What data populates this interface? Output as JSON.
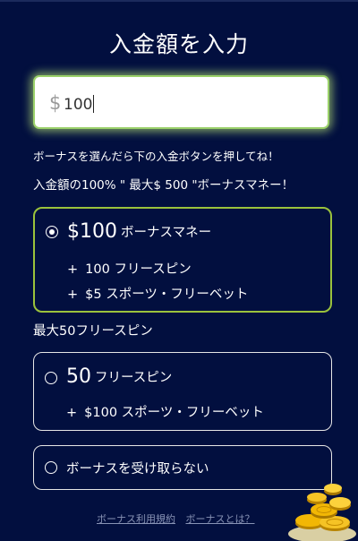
{
  "page": {
    "title": "入金額を入力"
  },
  "amount": {
    "currency": "$",
    "value": "100"
  },
  "hint": "ボーナスを選んだら下の入金ボタンを押してね！",
  "bonus_summary": "入金額の100% \" 最大$ 500 \"ボーナスマネー！",
  "options": [
    {
      "selected": true,
      "big": "$100",
      "label": "ボーナスマネー",
      "perks": [
        {
          "plus": "+",
          "text": "100  フリースピン"
        },
        {
          "plus": "+",
          "text": "$5  スポーツ・フリーベット"
        }
      ]
    },
    {
      "selected": false,
      "big": "50",
      "label": "フリースピン",
      "perks": [
        {
          "plus": "+",
          "text": "$100  スポーツ・フリーベット"
        }
      ]
    },
    {
      "selected": false,
      "label": "ボーナスを受け取らない"
    }
  ],
  "section_label": "最大50フリースピン",
  "footer": {
    "terms": "ボーナス利用規約",
    "about": "ボーナスとは？"
  },
  "colors": {
    "background": "#020f3f",
    "selected_border": "#9bc23c",
    "input_glow": "#9bd16a",
    "coin_gold": "#f2b705"
  },
  "icons": {
    "coins": "gold-coins-icon"
  }
}
